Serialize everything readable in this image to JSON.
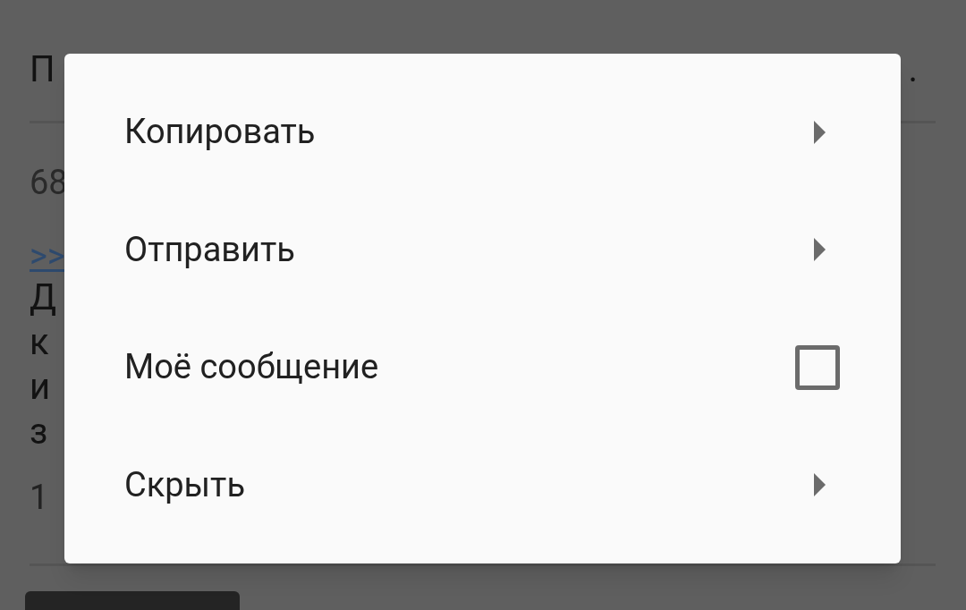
{
  "background": {
    "post_title_fragment": "П",
    "post_number_fragment": "68",
    "reply_link_fragment": ">>",
    "post_text_fragments": [
      "Д",
      "к",
      "и",
      "з"
    ],
    "post_footer_fragment": "1",
    "title_ellipsis": "."
  },
  "menu": {
    "items": [
      {
        "kind": "submenu",
        "label": "Копировать"
      },
      {
        "kind": "submenu",
        "label": "Отправить"
      },
      {
        "kind": "checkbox",
        "label": "Моё сообщение",
        "checked": false
      },
      {
        "kind": "submenu",
        "label": "Скрыть"
      }
    ]
  }
}
